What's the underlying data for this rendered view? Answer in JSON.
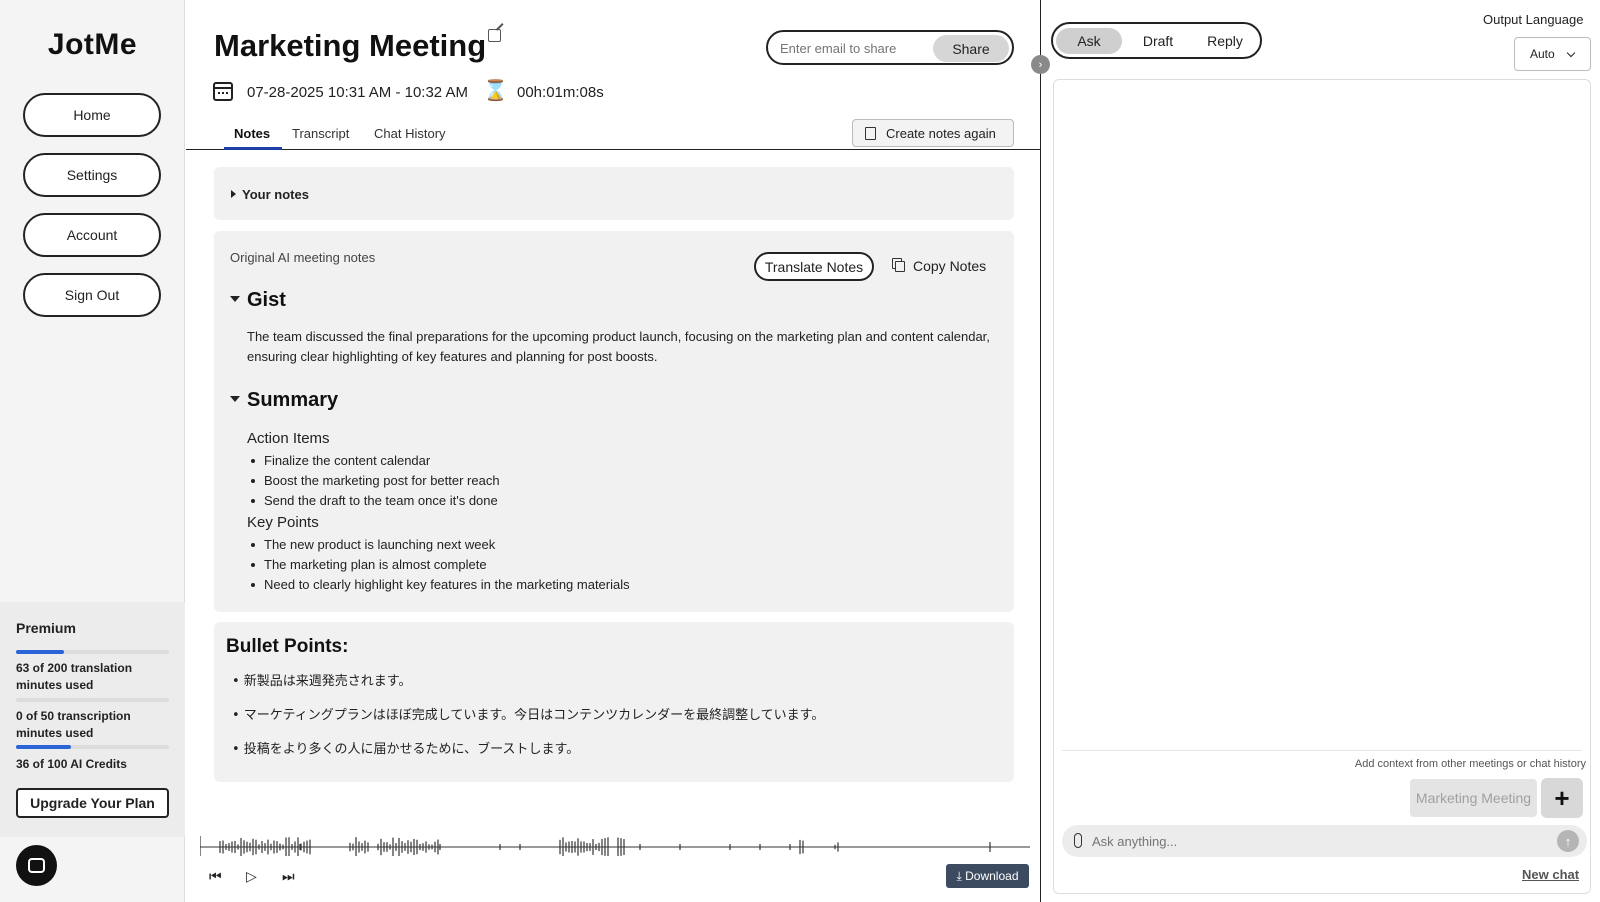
{
  "app": {
    "logo": "JotMe"
  },
  "sidebar": {
    "nav": [
      {
        "label": "Home"
      },
      {
        "label": "Settings"
      },
      {
        "label": "Account"
      },
      {
        "label": "Sign Out"
      }
    ],
    "plan": {
      "name": "Premium",
      "usage": [
        {
          "text": "63 of 200 translation minutes used",
          "fraction": 0.315
        },
        {
          "text": "0 of 50 transcription minutes used",
          "fraction": 0.0
        },
        {
          "text": "36 of 100 AI Credits",
          "fraction": 0.36
        }
      ],
      "upgrade_label": "Upgrade Your Plan"
    }
  },
  "meeting": {
    "title": "Marketing Meeting",
    "date_range": "07-28-2025 10:31 AM - 10:32 AM",
    "duration": "00h:01m:08s",
    "share_placeholder": "Enter email to share",
    "share_label": "Share",
    "tabs": [
      {
        "label": "Notes",
        "active": true
      },
      {
        "label": "Transcript",
        "active": false
      },
      {
        "label": "Chat History",
        "active": false
      }
    ],
    "recreate_label": "Create notes again"
  },
  "notes": {
    "your_notes_label": "Your notes",
    "original_label": "Original AI meeting notes",
    "translate_label": "Translate Notes",
    "copy_label": "Copy Notes",
    "gist_heading": "Gist",
    "gist_text": "The team discussed the final preparations for the upcoming product launch, focusing on the marketing plan and content calendar, ensuring clear highlighting of key features and planning for post boosts.",
    "summary_heading": "Summary",
    "action_items_heading": "Action Items",
    "action_items": [
      "Finalize the content calendar",
      "Boost the marketing post for better reach",
      "Send the draft to the team once it's done"
    ],
    "key_points_heading": "Key Points",
    "key_points": [
      "The new product is launching next week",
      "The marketing plan is almost complete",
      "Need to clearly highlight key features in the marketing materials"
    ],
    "bullet_points_heading": "Bullet Points:",
    "bullet_points": [
      "• 新製品は来週発売されます。",
      "• マーケティングプランはほぼ完成しています。今日はコンテンツカレンダーを最終調整しています。",
      "• 投稿をより多くの人に届かせるために、ブーストします。"
    ]
  },
  "player": {
    "download_label": "Download"
  },
  "assistant": {
    "modes": [
      {
        "label": "Ask",
        "active": true
      },
      {
        "label": "Draft",
        "active": false
      },
      {
        "label": "Reply",
        "active": false
      }
    ],
    "output_language_label": "Output Language",
    "output_language_value": "Auto",
    "context_label": "Add context from other meetings or chat history",
    "context_chip": "Marketing Meeting",
    "ask_placeholder": "Ask anything...",
    "new_chat_label": "New chat"
  }
}
